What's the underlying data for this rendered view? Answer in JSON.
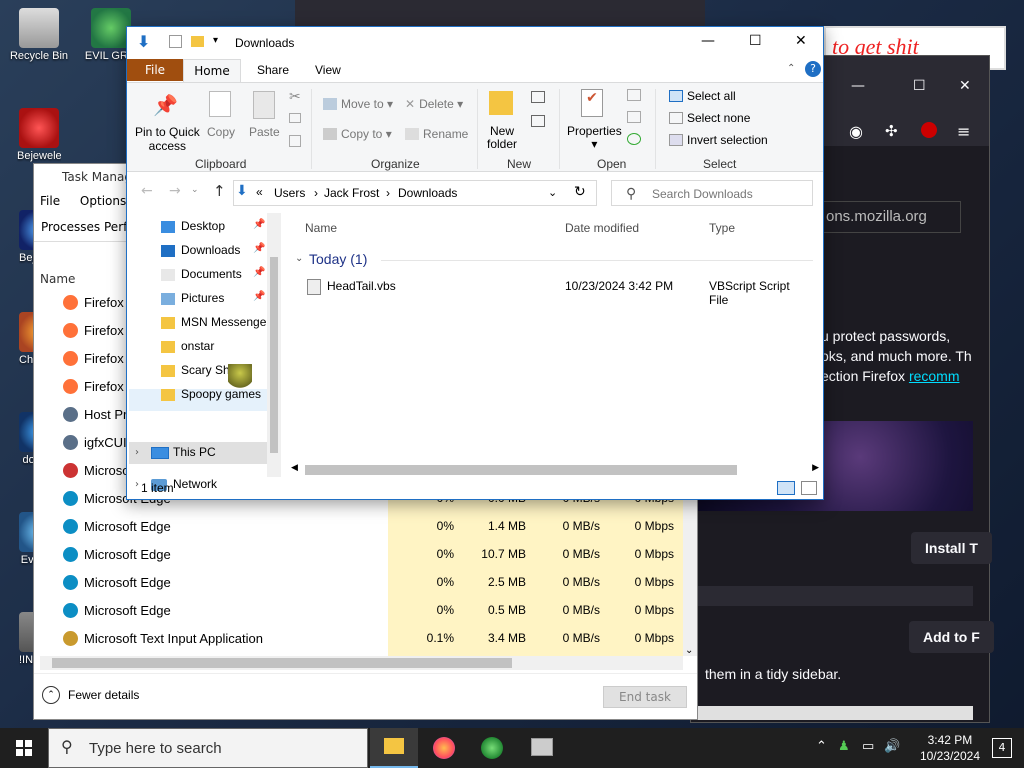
{
  "desktop": {
    "icons": [
      {
        "label": "Recycle Bin"
      },
      {
        "label": "EVIL GR..."
      },
      {
        "label": "Bejeweled Deluxe"
      },
      {
        "label": "Bejeweled Deluxe"
      },
      {
        "label": "Chromium Deluxe"
      },
      {
        "label": "does..."
      },
      {
        "label": "Every..."
      },
      {
        "label": "!INSTA..."
      }
    ],
    "banner": "to get shit"
  },
  "firefox": {
    "url_fragment": "ons.mozilla.org",
    "text1": "u protect passwords,",
    "text2": "oks, and much more. Th",
    "text3_plain": "ection Firefox ",
    "text3_link": "recomm",
    "install_button": "Install T",
    "add_button": "Add to F",
    "sidebar_text": "them in a tidy sidebar."
  },
  "taskmanager": {
    "title": "Task Manager",
    "menu": [
      "File",
      "Options"
    ],
    "tabs": [
      "Processes",
      "Perf"
    ],
    "col_name": "Name",
    "rows": [
      {
        "name": "Firefox",
        "icon": "firefox",
        "cpu": "",
        "mem": "",
        "disk": "",
        "net": ""
      },
      {
        "name": "Firefox",
        "icon": "firefox",
        "cpu": "",
        "mem": "",
        "disk": "",
        "net": ""
      },
      {
        "name": "Firefox",
        "icon": "firefox",
        "cpu": "",
        "mem": "",
        "disk": "",
        "net": ""
      },
      {
        "name": "Firefox",
        "icon": "firefox",
        "cpu": "",
        "mem": "",
        "disk": "",
        "net": ""
      },
      {
        "name": "Host Pro",
        "icon": "host",
        "cpu": "",
        "mem": "",
        "disk": "",
        "net": ""
      },
      {
        "name": "igfxCUIS",
        "icon": "host",
        "cpu": "",
        "mem": "",
        "disk": "",
        "net": ""
      },
      {
        "name": "Microso",
        "icon": "ms",
        "cpu": "",
        "mem": "",
        "disk": "",
        "net": ""
      },
      {
        "name": "Microsoft Edge",
        "icon": "edge",
        "cpu": "0%",
        "mem": "0.0 MB",
        "disk": "0 MB/s",
        "net": "0 Mbps"
      },
      {
        "name": "Microsoft Edge",
        "icon": "edge",
        "cpu": "0%",
        "mem": "1.4 MB",
        "disk": "0 MB/s",
        "net": "0 Mbps"
      },
      {
        "name": "Microsoft Edge",
        "icon": "edge",
        "cpu": "0%",
        "mem": "10.7 MB",
        "disk": "0 MB/s",
        "net": "0 Mbps"
      },
      {
        "name": "Microsoft Edge",
        "icon": "edge",
        "cpu": "0%",
        "mem": "2.5 MB",
        "disk": "0 MB/s",
        "net": "0 Mbps"
      },
      {
        "name": "Microsoft Edge",
        "icon": "edge",
        "cpu": "0%",
        "mem": "0.5 MB",
        "disk": "0 MB/s",
        "net": "0 Mbps"
      },
      {
        "name": "Microsoft Text Input Application",
        "icon": "text",
        "cpu": "0.1%",
        "mem": "3.4 MB",
        "disk": "0 MB/s",
        "net": "0 Mbps"
      }
    ],
    "fewer_details": "Fewer details",
    "end_task": "End task"
  },
  "explorer": {
    "title": "Downloads",
    "ribbon_tabs": {
      "file": "File",
      "home": "Home",
      "share": "Share",
      "view": "View"
    },
    "clipboard": {
      "pin": "Pin to Quick",
      "pin2": "access",
      "copy": "Copy",
      "paste": "Paste",
      "group": "Clipboard"
    },
    "organize": {
      "move_to": "Move to",
      "copy_to": "Copy to",
      "delete": "Delete",
      "rename": "Rename",
      "group": "Organize"
    },
    "new": {
      "new_folder": "New",
      "new_folder2": "folder",
      "group": "New"
    },
    "open": {
      "properties": "Properties",
      "group": "Open"
    },
    "select": {
      "all": "Select all",
      "none": "Select none",
      "invert": "Invert selection",
      "group": "Select"
    },
    "address": {
      "prefix": "«",
      "crumbs": [
        "Users",
        "Jack Frost",
        "Downloads"
      ]
    },
    "search_placeholder": "Search Downloads",
    "nav": {
      "quick": [
        {
          "label": "Desktop",
          "pinned": true
        },
        {
          "label": "Downloads",
          "pinned": true
        },
        {
          "label": "Documents",
          "pinned": true
        },
        {
          "label": "Pictures",
          "pinned": true
        },
        {
          "label": "MSN Messenger",
          "pinned": false
        },
        {
          "label": "onstar",
          "pinned": false
        },
        {
          "label": "Scary Shit",
          "pinned": false
        },
        {
          "label": "Spoopy games",
          "pinned": false
        }
      ],
      "this_pc": "This PC",
      "network": "Network"
    },
    "columns": {
      "name": "Name",
      "date": "Date modified",
      "type": "Type"
    },
    "group_label": "Today (1)",
    "file": {
      "name": "HeadTail.vbs",
      "date": "10/23/2024 3:42 PM",
      "type": "VBScript Script File"
    },
    "status": "1 item"
  },
  "taskbar": {
    "search_placeholder": "Type here to search",
    "time": "3:42 PM",
    "date": "10/23/2024",
    "notifications": "4"
  }
}
